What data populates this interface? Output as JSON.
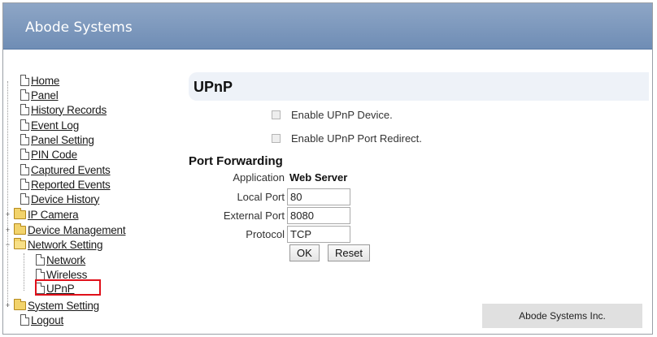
{
  "header": {
    "brand": "Abode Systems"
  },
  "nav": {
    "home": "Home",
    "panel": "Panel",
    "history_records": "History Records",
    "event_log": "Event Log",
    "panel_setting": "Panel Setting",
    "pin_code": "PIN Code",
    "captured_events": "Captured Events",
    "reported_events": "Reported Events",
    "device_history": "Device History",
    "ip_camera": "IP Camera",
    "device_management": "Device Management",
    "network_setting": "Network Setting",
    "network": "Network",
    "wireless": "Wireless",
    "upnp": "UPnP",
    "system_setting": "System Setting",
    "logout": "Logout"
  },
  "main": {
    "title": "UPnP",
    "enable_device_label": "Enable UPnP Device.",
    "enable_port_redirect_label": "Enable UPnP Port Redirect.",
    "port_forwarding": {
      "title": "Port Forwarding",
      "application_label": "Application",
      "application_value": "Web Server",
      "local_port_label": "Local Port",
      "local_port_value": "80",
      "external_port_label": "External Port",
      "external_port_value": "8080",
      "protocol_label": "Protocol",
      "protocol_value": "TCP"
    },
    "ok_label": "OK",
    "reset_label": "Reset"
  },
  "footer": {
    "text": "Abode Systems Inc."
  }
}
